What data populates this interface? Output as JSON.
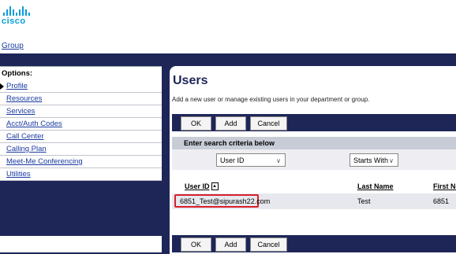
{
  "header": {
    "brand": "cisco",
    "group_link": "Group"
  },
  "sidebar": {
    "title": "Options:",
    "items": [
      {
        "label": "Profile",
        "active": true
      },
      {
        "label": "Resources"
      },
      {
        "label": "Services"
      },
      {
        "label": "Acct/Auth Codes"
      },
      {
        "label": "Call Center"
      },
      {
        "label": "Calling Plan"
      },
      {
        "label": "Meet-Me Conferencing"
      },
      {
        "label": "Utilities"
      }
    ]
  },
  "main": {
    "title": "Users",
    "subtitle": "Add a new user or manage existing users in your department or group.",
    "buttons": {
      "ok": "OK",
      "add": "Add",
      "cancel": "Cancel"
    },
    "search": {
      "header": "Enter search criteria below",
      "field": "User ID",
      "mode": "Starts With"
    },
    "table": {
      "columns": [
        "User ID",
        "Last Name",
        "First Nam"
      ],
      "rows": [
        {
          "user_id": "6851_Test@sipurash22.com",
          "last_name": "Test",
          "first_name": "6851"
        }
      ]
    }
  },
  "colors": {
    "navy": "#1e2658",
    "link": "#1a3aa0",
    "highlight": "#d8202a",
    "cisco": "#049fd9"
  }
}
